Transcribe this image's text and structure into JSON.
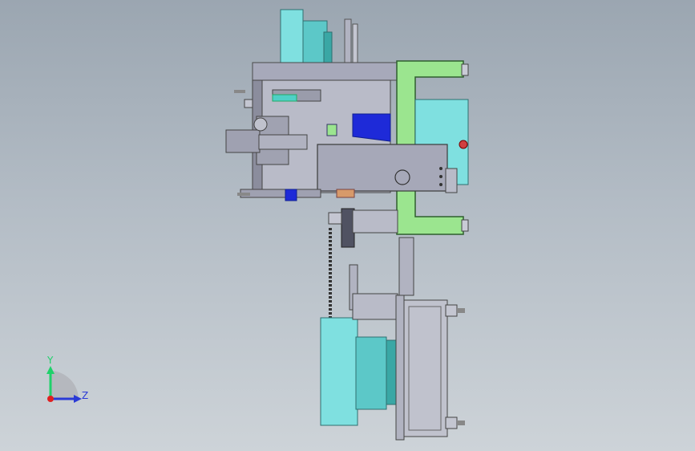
{
  "viewport": {
    "background_top": "#9ba6b1",
    "background_bottom": "#cdd3d8"
  },
  "model": {
    "part_colors": {
      "teal": "#7fe0e0",
      "teal_dark": "#2f8f8c",
      "green": "#9be58f",
      "gray": "#a6a8b8",
      "gray_dark": "#6a6c7c",
      "blue": "#1e2ad8",
      "red": "#d04040"
    }
  },
  "triad": {
    "y_label": "Y",
    "z_label": "Z",
    "y_color": "#1fd16a",
    "z_color": "#2a3ad6",
    "origin_color": "#e02020"
  }
}
